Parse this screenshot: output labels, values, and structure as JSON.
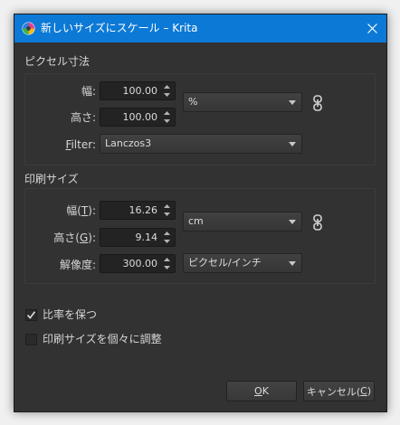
{
  "window": {
    "title": "新しいサイズにスケール – Krita",
    "close_symbol": "✕",
    "title_color": "#0c79d6"
  },
  "pixel_dimensions": {
    "section_title": "ピクセル寸法",
    "width_label": "幅:",
    "width_value": "100.00",
    "height_label": "高さ:",
    "height_value": "100.00",
    "unit": "%",
    "filter_label": "ilter:",
    "filter_accel": "F",
    "filter_value": "Lanczos3"
  },
  "print_size": {
    "section_title": "印刷サイズ",
    "width_label_pre": "幅(",
    "width_accel": "T",
    "width_label_post": "):",
    "width_value": "16.26",
    "height_label_pre": "高さ(",
    "height_accel": "G",
    "height_label_post": "):",
    "height_value": "9.14",
    "unit": "cm",
    "resolution_label": "解像度:",
    "resolution_value": "300.00",
    "resolution_unit": "ピクセル/インチ"
  },
  "options": {
    "keep_ratio_label": "比率を保つ",
    "keep_ratio_checked": true,
    "adjust_separately_label": "印刷サイズを個々に調整",
    "adjust_separately_checked": false
  },
  "buttons": {
    "ok_accel": "O",
    "ok_rest": "K",
    "cancel_pre": "キャンセル(",
    "cancel_accel": "C",
    "cancel_post": ")"
  },
  "icons": {
    "app": "krita-logo-icon",
    "close": "close-icon",
    "link": "chain-link-icon",
    "spin_up": "triangle-up-icon",
    "spin_down": "triangle-down-icon",
    "dropdown": "chevron-down-icon",
    "checkmark": "checkmark-icon"
  }
}
